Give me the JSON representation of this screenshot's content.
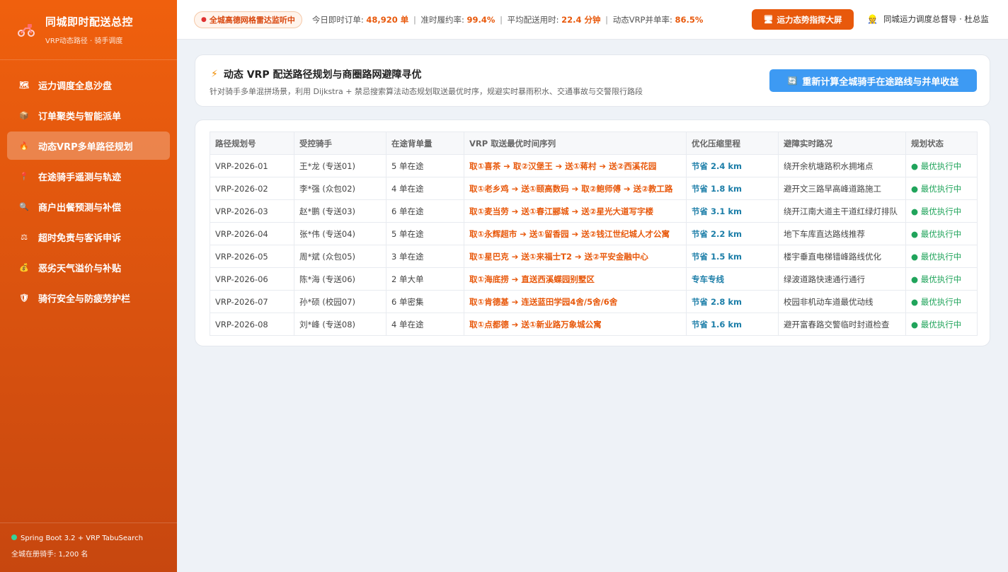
{
  "sidebar": {
    "brand_title": "同城即时配送总控",
    "brand_subtitle": "VRP动态路径 · 骑手调度",
    "items": [
      {
        "label": "运力调度全息沙盘",
        "icon": "map-icon",
        "glyph": "🗺"
      },
      {
        "label": "订单聚类与智能派单",
        "icon": "package-icon",
        "glyph": "📦"
      },
      {
        "label": "动态VRP多单路径规划",
        "icon": "flame-icon",
        "glyph": "🔥"
      },
      {
        "label": "在途骑手遥测与轨迹",
        "icon": "pin-icon",
        "glyph": "📍"
      },
      {
        "label": "商户出餐预测与补偿",
        "icon": "search-clock-icon",
        "glyph": "🔍"
      },
      {
        "label": "超时免责与客诉申诉",
        "icon": "scale-icon",
        "glyph": "⚖"
      },
      {
        "label": "恶劣天气溢价与补贴",
        "icon": "money-bag-icon",
        "glyph": "💰"
      },
      {
        "label": "骑行安全与防疲劳护栏",
        "icon": "shield-icon",
        "glyph": "🛡"
      }
    ],
    "footer_line1": "Spring Boot 3.2 + VRP TabuSearch",
    "footer_line2": "全城在册骑手: 1,200 名"
  },
  "header": {
    "radar_badge": "全城高德网格雷达监听中",
    "metrics": {
      "orders_label": "今日即时订单:",
      "orders_value": "48,920 单",
      "ontime_label": "准时履约率:",
      "ontime_value": "99.4%",
      "avg_label": "平均配送用时:",
      "avg_value": "22.4 分钟",
      "merge_label": "动态VRP并单率:",
      "merge_value": "86.5%"
    },
    "big_screen_button": "运力态势指挥大屏",
    "user": "同城运力调度总督导 · 杜总监"
  },
  "panel": {
    "title": "动态 VRP 配送路径规划与商圈路网避障寻优",
    "description": "针对骑手多单混拼场景，利用 Dijkstra + 禁忌搜索算法动态规划取送最优时序，规避实时暴雨积水、交通事故与交警限行路段",
    "recalc_button": "重新计算全城骑手在途路线与并单收益"
  },
  "table": {
    "headers": [
      "路径规划号",
      "受控骑手",
      "在途背单量",
      "VRP 取送最优时间序列",
      "优化压缩里程",
      "避障实时路况",
      "规划状态"
    ],
    "rows": [
      {
        "id": "VRP-2026-01",
        "rider": "王*龙 (专送01)",
        "load": "5 单在途",
        "route": "取①喜茶 ➔ 取②汉堡王 ➔ 送①蒋村 ➔ 送②西溪花园",
        "saving": "节省 2.4 km",
        "road": "绕开余杭塘路积水拥堵点",
        "status": "● 最优执行中"
      },
      {
        "id": "VRP-2026-02",
        "rider": "李*强 (众包02)",
        "load": "4 单在途",
        "route": "取①老乡鸡 ➔ 送①颐高数码 ➔ 取②鲍师傅 ➔ 送②教工路",
        "saving": "节省 1.8 km",
        "road": "避开文三路早高峰道路施工",
        "status": "● 最优执行中"
      },
      {
        "id": "VRP-2026-03",
        "rider": "赵*鹏 (专送03)",
        "load": "6 单在途",
        "route": "取①麦当劳 ➔ 送①春江郦城 ➔ 送②星光大道写字楼",
        "saving": "节省 3.1 km",
        "road": "绕开江南大道主干道红绿灯排队",
        "status": "● 最优执行中"
      },
      {
        "id": "VRP-2026-04",
        "rider": "张*伟 (专送04)",
        "load": "5 单在途",
        "route": "取①永辉超市 ➔ 送①留香园 ➔ 送②钱江世纪城人才公寓",
        "saving": "节省 2.2 km",
        "road": "地下车库直达路线推荐",
        "status": "● 最优执行中"
      },
      {
        "id": "VRP-2026-05",
        "rider": "周*斌 (众包05)",
        "load": "3 单在途",
        "route": "取①星巴克 ➔ 送①来福士T2 ➔ 送②平安金融中心",
        "saving": "节省 1.5 km",
        "road": "楼宇垂直电梯错峰路线优化",
        "status": "● 最优执行中"
      },
      {
        "id": "VRP-2026-06",
        "rider": "陈*海 (专送06)",
        "load": "2 单大单",
        "route": "取①海底捞 ➔ 直送西溪蝶园别墅区",
        "saving": "专车专线",
        "road": "绿波道路快速通行通行",
        "status": "● 最优执行中"
      },
      {
        "id": "VRP-2026-07",
        "rider": "孙*硕 (校园07)",
        "load": "6 单密集",
        "route": "取①肯德基 ➔ 连送蓝田学园4舍/5舍/6舍",
        "saving": "节省 2.8 km",
        "road": "校园非机动车道最优动线",
        "status": "● 最优执行中"
      },
      {
        "id": "VRP-2026-08",
        "rider": "刘*峰 (专送08)",
        "load": "4 单在途",
        "route": "取①点都德 ➔ 送①新业路万象城公寓",
        "saving": "节省 1.6 km",
        "road": "避开富春路交警临时封道检查",
        "status": "● 最优执行中"
      }
    ]
  },
  "colors": {
    "brand_orange": "#e8590c",
    "button_blue": "#3d9af3",
    "status_green": "#20a45b",
    "saving_teal": "#1c7ea8"
  }
}
